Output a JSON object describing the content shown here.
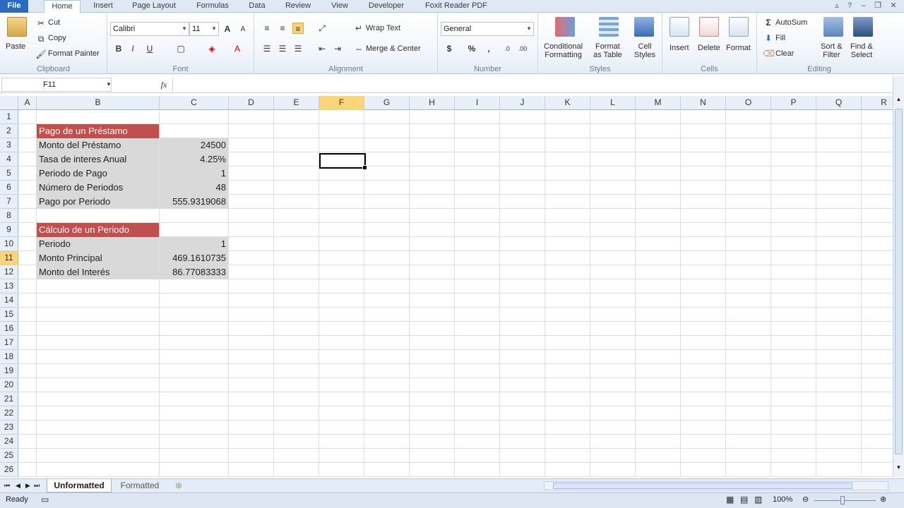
{
  "tabs": [
    "File",
    "Home",
    "Insert",
    "Page Layout",
    "Formulas",
    "Data",
    "Review",
    "View",
    "Developer",
    "Foxit Reader PDF"
  ],
  "ribbon": {
    "clipboard": {
      "paste": "Paste",
      "cut": "Cut",
      "copy": "Copy",
      "format_painter": "Format Painter",
      "label": "Clipboard"
    },
    "font": {
      "name": "Calibri",
      "size": "11",
      "label": "Font"
    },
    "alignment": {
      "wrap": "Wrap Text",
      "merge": "Merge & Center",
      "label": "Alignment"
    },
    "number": {
      "format": "General",
      "currency": "$",
      "percent": "%",
      "comma": ",",
      "label": "Number"
    },
    "styles": {
      "cond": "Conditional",
      "cond2": "Formatting",
      "table": "Format",
      "table2": "as Table",
      "cell": "Cell",
      "cell2": "Styles",
      "label": "Styles"
    },
    "cells": {
      "insert": "Insert",
      "delete": "Delete",
      "format": "Format",
      "label": "Cells"
    },
    "editing": {
      "autosum": "AutoSum",
      "fill": "Fill",
      "clear": "Clear",
      "sort": "Sort &",
      "sort2": "Filter",
      "find": "Find &",
      "find2": "Select",
      "label": "Editing"
    }
  },
  "formula_bar": {
    "name_box": "F11",
    "fx": "fx",
    "content": ""
  },
  "columns": [
    "A",
    "B",
    "C",
    "D",
    "E",
    "F",
    "G",
    "H",
    "I",
    "J",
    "K",
    "L",
    "M",
    "N",
    "O",
    "P",
    "Q",
    "R"
  ],
  "rows": [
    "1",
    "2",
    "3",
    "4",
    "5",
    "6",
    "7",
    "8",
    "9",
    "10",
    "11",
    "12",
    "13",
    "14",
    "15",
    "16",
    "17",
    "18",
    "19",
    "20",
    "21",
    "22",
    "23",
    "24",
    "25",
    "26"
  ],
  "cells": {
    "B2": "Pago de un Préstamo",
    "B3": "Monto del Préstamo",
    "C3": "24500",
    "B4": "Tasa de interes Anual",
    "C4": "4.25%",
    "B5": "Periodo de Pago",
    "C5": "1",
    "B6": "Número de Periodos",
    "C6": "48",
    "B7": "Pago por Periodo",
    "C7": "555.9319068",
    "B9": "Cálculo de un Periodo",
    "B10": "Periodo",
    "C10": "1",
    "B11": "Monto Principal",
    "C11": "469.1610735",
    "B12": "Monto del Interés",
    "C12": "86.77083333"
  },
  "sheets": [
    "Unformatted",
    "Formatted"
  ],
  "status": {
    "mode": "Ready",
    "zoom": "100%"
  },
  "colors": {
    "header_fill": "#c0504d",
    "label_fill": "#d9d9d9"
  }
}
